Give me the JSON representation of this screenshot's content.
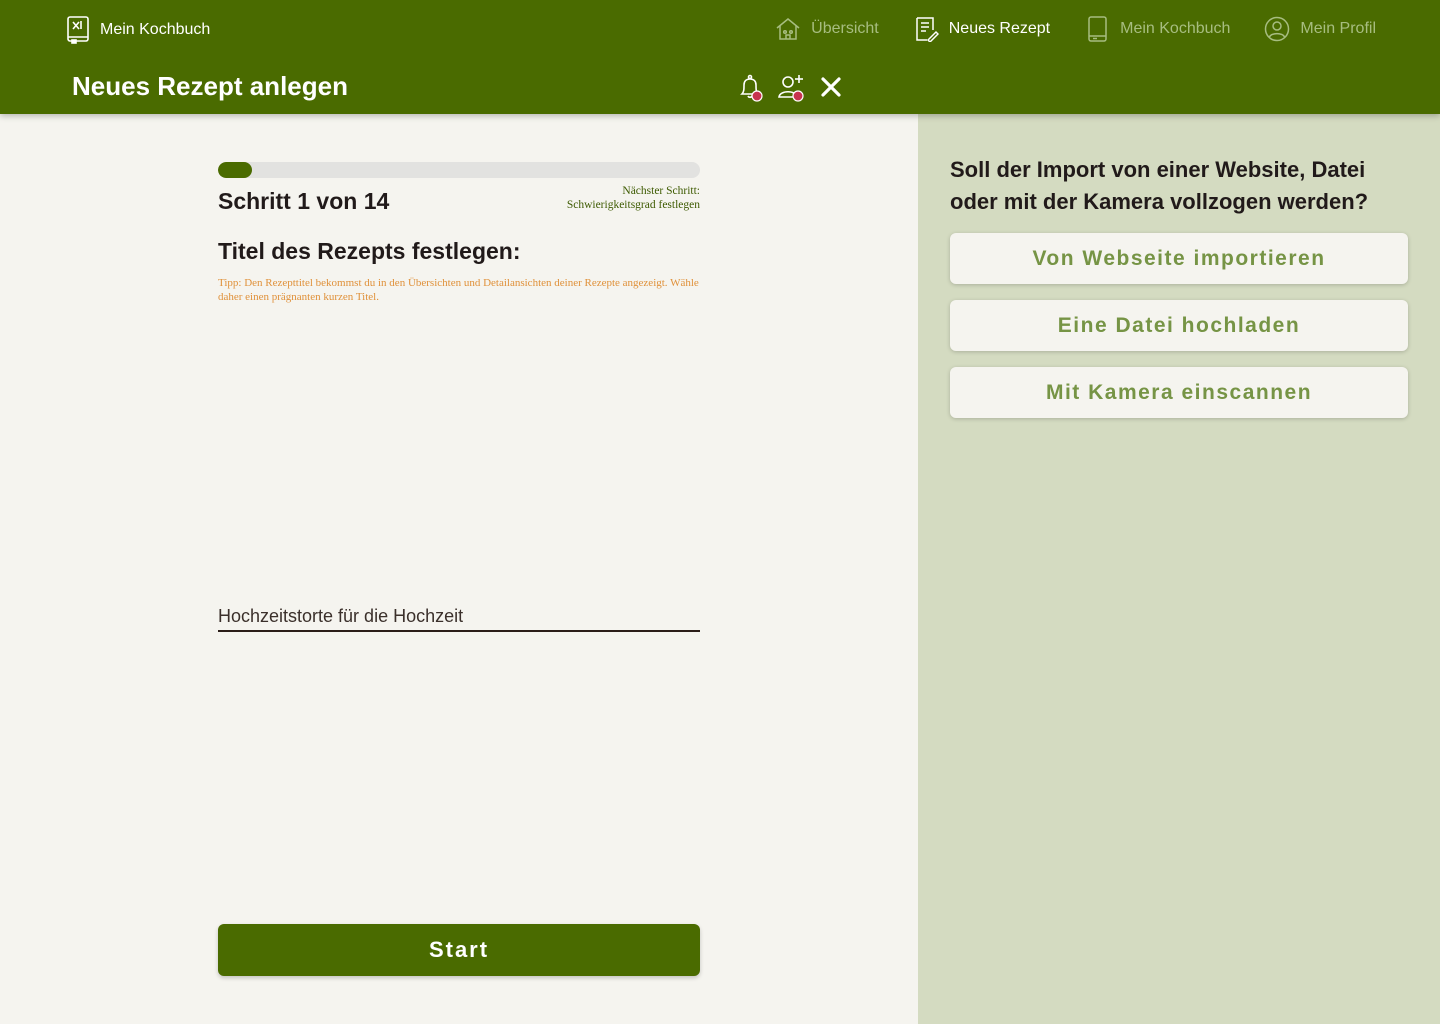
{
  "app": {
    "name": "Mein Kochbuch"
  },
  "nav": [
    {
      "label": "Übersicht",
      "icon": "home-icon",
      "active": false
    },
    {
      "label": "Neues Rezept",
      "icon": "note-edit-icon",
      "active": true
    },
    {
      "label": "Mein Kochbuch",
      "icon": "book-icon",
      "active": false
    },
    {
      "label": "Mein Profil",
      "icon": "user-icon",
      "active": false
    }
  ],
  "header": {
    "title": "Neues Rezept anlegen",
    "actions": [
      "notification-bell-icon",
      "add-user-icon",
      "close-icon"
    ]
  },
  "wizard": {
    "progress": 0.07,
    "step_label": "Schritt 1 von 14",
    "next_step_label": "Nächster Schritt:",
    "next_step_value": "Schwierigkeitsgrad festlegen",
    "section_title": "Titel des Rezepts festlegen:",
    "tip": "Tipp: Den Rezepttitel bekommst du in den Übersichten und Detailansichten deiner Rezepte angezeigt. Wähle daher einen prägnanten kurzen Titel.",
    "title_value": "Hochzeitstorte für die Hochzeit",
    "start_label": "Start"
  },
  "import": {
    "question": "Soll der Import von einer Website, Datei oder mit der Kamera vollzogen werden?",
    "website_label": "Von Webseite importieren",
    "file_label": "Eine Datei hochladen",
    "camera_label": "Mit Kamera einscannen"
  },
  "colors": {
    "primary": "#4a6b00",
    "background": "#f5f4ef",
    "sidebar": "#d4dbc1",
    "tip": "#e0913a",
    "notification": "#c7334f"
  }
}
